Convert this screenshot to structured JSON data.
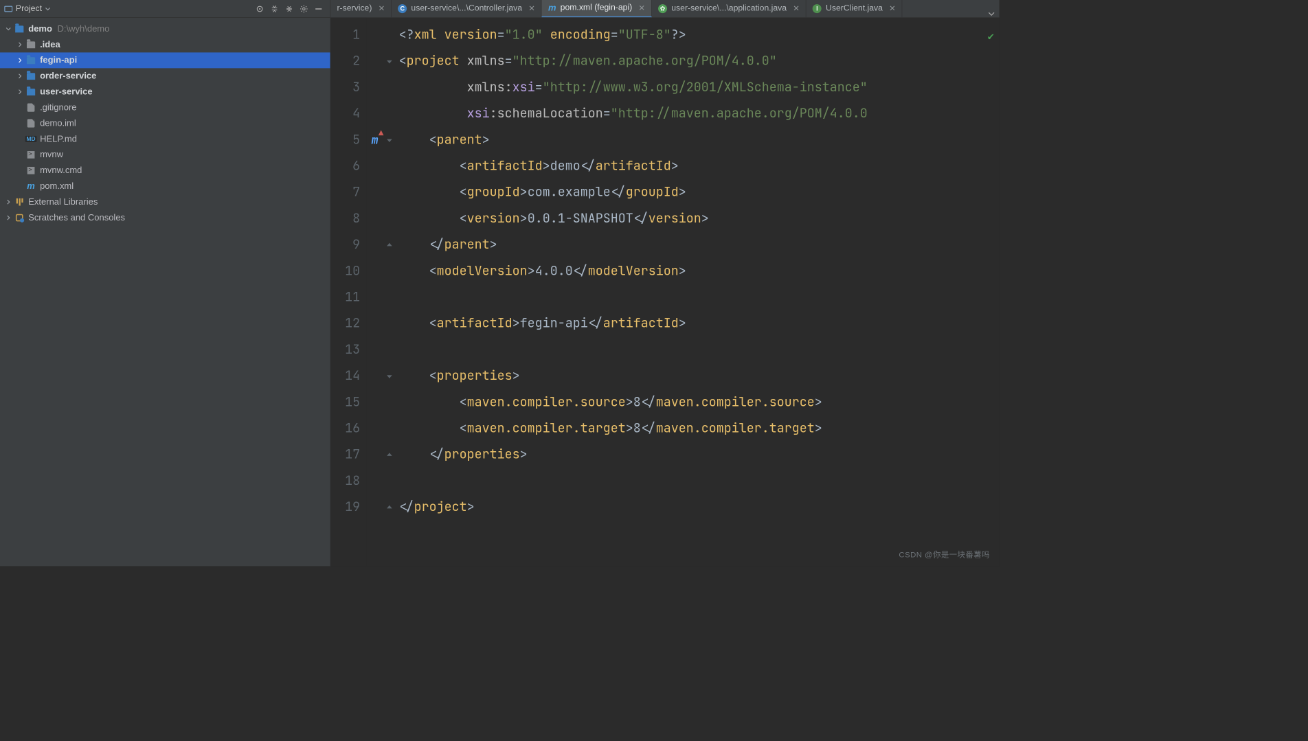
{
  "sidebar": {
    "title": "Project",
    "root": {
      "name": "demo",
      "path": "D:\\wyh\\demo"
    },
    "items": [
      {
        "label": ".idea",
        "kind": "folder",
        "depth": 1,
        "expandable": true
      },
      {
        "label": "fegin-api",
        "kind": "module",
        "depth": 1,
        "expandable": true,
        "selected": true
      },
      {
        "label": "order-service",
        "kind": "module",
        "depth": 1,
        "expandable": true
      },
      {
        "label": "user-service",
        "kind": "module",
        "depth": 1,
        "expandable": true
      },
      {
        "label": ".gitignore",
        "kind": "file",
        "depth": 1
      },
      {
        "label": "demo.iml",
        "kind": "file",
        "depth": 1
      },
      {
        "label": "HELP.md",
        "kind": "md",
        "depth": 1
      },
      {
        "label": "mvnw",
        "kind": "sh",
        "depth": 1
      },
      {
        "label": "mvnw.cmd",
        "kind": "sh",
        "depth": 1
      },
      {
        "label": "pom.xml",
        "kind": "maven",
        "depth": 1
      }
    ],
    "footer": [
      {
        "label": "External Libraries",
        "kind": "lib"
      },
      {
        "label": "Scratches and Consoles",
        "kind": "scratch"
      }
    ]
  },
  "tabs": [
    {
      "label": "r-service)",
      "icon": "none",
      "truncated": true
    },
    {
      "label": "user-service\\...\\Controller.java",
      "icon": "class"
    },
    {
      "label": "pom.xml (fegin-api)",
      "icon": "maven",
      "active": true
    },
    {
      "label": "user-service\\...\\application.java",
      "icon": "leaf"
    },
    {
      "label": "UserClient.java",
      "icon": "iface"
    }
  ],
  "editor": {
    "lines": [
      {
        "n": 1,
        "html": "<span class='punct'>&lt;?</span><span class='tag'>xml version</span><span class='punct'>=</span><span class='str'>\"1.0\"</span> <span class='tag'>encoding</span><span class='punct'>=</span><span class='str'>\"UTF-8\"</span><span class='punct'>?&gt;</span>"
      },
      {
        "n": 2,
        "fold": "top",
        "html": "<span class='punct'>&lt;</span><span class='tag'>project </span><span class='attr'>xmlns</span><span class='punct'>=</span><span class='str'>\"http://maven.apache.org/POM/4.0.0\"</span>"
      },
      {
        "n": 3,
        "html": "         <span class='attr'>xmlns:</span><span class='ns'>xsi</span><span class='punct'>=</span><span class='str'>\"http://www.w3.org/2001/XMLSchema-instance\"</span>"
      },
      {
        "n": 4,
        "html": "         <span class='ns'>xsi</span><span class='attr'>:schemaLocation</span><span class='punct'>=</span><span class='str'>\"http://maven.apache.org/POM/4.0.0 </span>"
      },
      {
        "n": 5,
        "mark": "m",
        "fold": "top",
        "html": "    <span class='punct'>&lt;</span><span class='tag'>parent</span><span class='punct'>&gt;</span>"
      },
      {
        "n": 6,
        "html": "        <span class='punct'>&lt;</span><span class='tag'>artifactId</span><span class='punct'>&gt;</span><span class='txt'>demo</span><span class='punct'>&lt;/</span><span class='tag'>artifactId</span><span class='punct'>&gt;</span>"
      },
      {
        "n": 7,
        "html": "        <span class='punct'>&lt;</span><span class='tag'>groupId</span><span class='punct'>&gt;</span><span class='txt'>com.example</span><span class='punct'>&lt;/</span><span class='tag'>groupId</span><span class='punct'>&gt;</span>"
      },
      {
        "n": 8,
        "html": "        <span class='punct'>&lt;</span><span class='tag'>version</span><span class='punct'>&gt;</span><span class='txt'>0.0.1-SNAPSHOT</span><span class='punct'>&lt;/</span><span class='tag'>version</span><span class='punct'>&gt;</span>"
      },
      {
        "n": 9,
        "fold": "bot",
        "html": "    <span class='punct'>&lt;/</span><span class='tag'>parent</span><span class='punct'>&gt;</span>"
      },
      {
        "n": 10,
        "html": "    <span class='punct'>&lt;</span><span class='tag'>modelVersion</span><span class='punct'>&gt;</span><span class='txt'>4.0.0</span><span class='punct'>&lt;/</span><span class='tag'>modelVersion</span><span class='punct'>&gt;</span>"
      },
      {
        "n": 11,
        "html": ""
      },
      {
        "n": 12,
        "html": "    <span class='punct'>&lt;</span><span class='tag'>artifactId</span><span class='punct'>&gt;</span><span class='txt'>fegin-api</span><span class='punct'>&lt;/</span><span class='tag'>artifactId</span><span class='punct'>&gt;</span>"
      },
      {
        "n": 13,
        "html": ""
      },
      {
        "n": 14,
        "fold": "top",
        "html": "    <span class='punct'>&lt;</span><span class='tag'>properties</span><span class='punct'>&gt;</span>"
      },
      {
        "n": 15,
        "html": "        <span class='punct'>&lt;</span><span class='tag'>maven.compiler.source</span><span class='punct'>&gt;</span><span class='txt'>8</span><span class='punct'>&lt;/</span><span class='tag'>maven.compiler.source</span><span class='punct'>&gt;</span>"
      },
      {
        "n": 16,
        "html": "        <span class='punct'>&lt;</span><span class='tag'>maven.compiler.target</span><span class='punct'>&gt;</span><span class='txt'>8</span><span class='punct'>&lt;/</span><span class='tag'>maven.compiler.target</span><span class='punct'>&gt;</span>"
      },
      {
        "n": 17,
        "fold": "bot",
        "html": "    <span class='punct'>&lt;/</span><span class='tag'>properties</span><span class='punct'>&gt;</span>"
      },
      {
        "n": 18,
        "html": ""
      },
      {
        "n": 19,
        "fold": "bot",
        "html": "<span class='punct'>&lt;/</span><span class='tag'>project</span><span class='punct'>&gt;</span>"
      }
    ]
  },
  "watermark": "CSDN @你是一块番薯吗"
}
